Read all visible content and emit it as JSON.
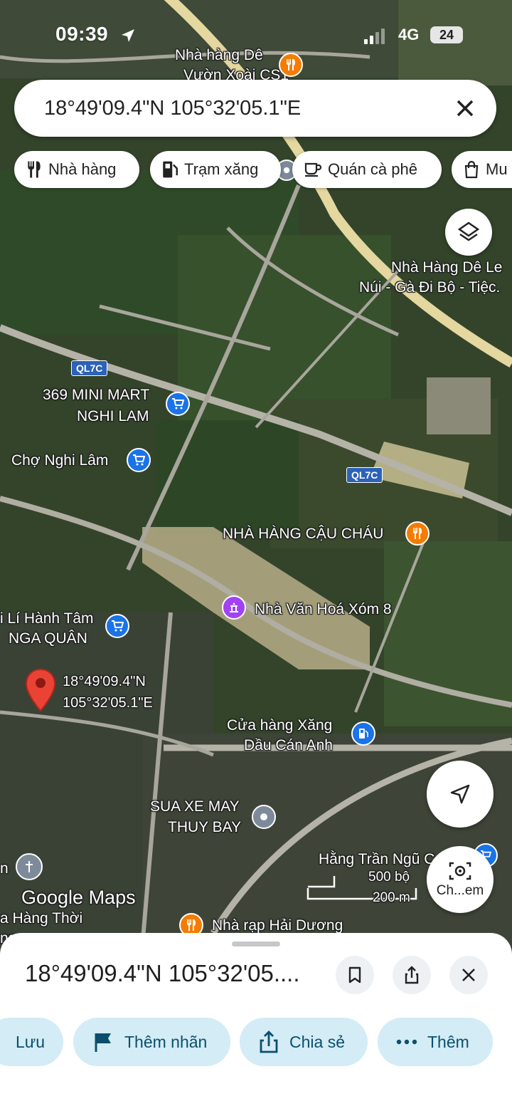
{
  "status_bar": {
    "time": "09:39",
    "network": "4G",
    "battery": "24"
  },
  "search": {
    "value": "18°49'09.4\"N 105°32'05.1\"E"
  },
  "chips": [
    {
      "label": "Nhà hàng",
      "icon": "restaurant-icon"
    },
    {
      "label": "Trạm xăng",
      "icon": "gas-station-icon"
    },
    {
      "label": "Quán cà phê",
      "icon": "coffee-icon"
    },
    {
      "label": "Mu",
      "icon": "shopping-bag-icon"
    }
  ],
  "map": {
    "labels": {
      "nha_hang_de_1": "Nhà hàng Dê",
      "nha_hang_de_2": "Vườn Xoài CS1",
      "nha_hang_de_le_1": "Nhà Hàng Dê Le",
      "nha_hang_de_le_2": "Núi - Gà Đi Bộ - Tiệc.",
      "road_ql7c_1": "QL7C",
      "road_ql7c_2": "QL7C",
      "minimart_1": "369 MINI MART",
      "minimart_2": "NGHI LAM",
      "cho_nghi_lam": "Chợ Nghi Lâm",
      "cau_chau": "NHÀ HÀNG CẬU CHÁU",
      "van_hoa": "Nhà Văn Hoá Xóm 8",
      "nga_quan_1": "i Lí Hành Tâm",
      "nga_quan_2": "NGA QUÂN",
      "pin_coord_1": "18°49'09.4\"N",
      "pin_coord_2": "105°32'05.1\"E",
      "xang_1": "Cửa hàng Xăng",
      "xang_2": "Dầu Cán Anh",
      "sua_xe_1": "SUA XE MAY",
      "sua_xe_2": "THUY BAY",
      "hang_tran": "Hằng Trần Ngũ C",
      "hang_thoi": "a Hàng Thời",
      "ng": "ng",
      "nha_rap": "Nhà rạp Hải Dương",
      "n_left": "n"
    },
    "watermark": "Google Maps",
    "scale": {
      "imperial": "500 bộ",
      "metric": "200 m"
    },
    "lens_label": "Ch...em",
    "colors": {
      "pin_red": "#ea4335",
      "shopping_blue": "#1a73e8",
      "food_orange": "#f57c00",
      "culture_purple": "#a142f4"
    }
  },
  "sheet": {
    "title": "18°49'09.4\"N 105°32'05....",
    "actions": [
      {
        "label": "Lưu",
        "icon": "bookmark-icon"
      },
      {
        "label": "Thêm nhãn",
        "icon": "flag-icon"
      },
      {
        "label": "Chia sẻ",
        "icon": "share-icon"
      },
      {
        "label": "Thêm",
        "icon": "more-dots-icon"
      }
    ]
  }
}
